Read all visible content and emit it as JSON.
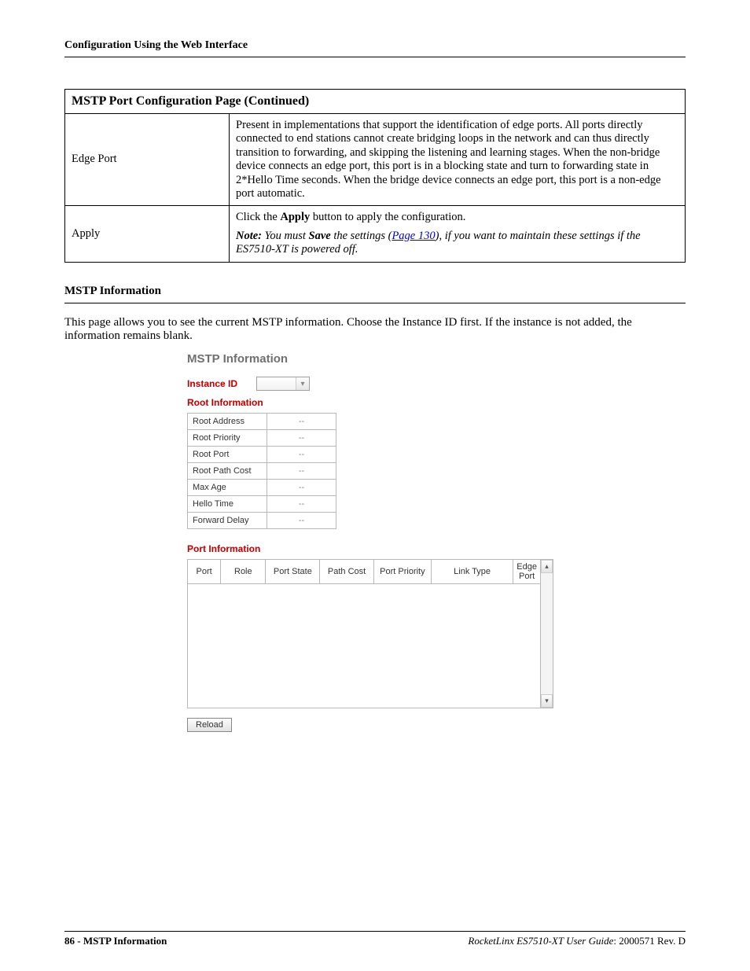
{
  "header": {
    "title": "Configuration Using the Web Interface"
  },
  "table": {
    "caption": "MSTP Port Configuration Page  (Continued)",
    "rows": [
      {
        "label": "Edge Port",
        "desc": "Present in implementations that support the identification of edge ports. All ports directly connected to end stations cannot create bridging loops in the network and can thus directly transition to forwarding, and skipping the listening and learning stages. When the non-bridge device connects an edge port, this port is in a blocking state and turn to forwarding state in 2*Hello Time seconds. When the bridge device connects an edge port, this port is a non-edge port automatic."
      },
      {
        "label": "Apply",
        "line1_a": "Click the ",
        "line1_b": "Apply",
        "line1_c": " button to apply the configuration.",
        "note_prefix": "Note:",
        "note_a": " You must ",
        "note_save": "Save",
        "note_b": " the settings (",
        "note_link": "Page 130",
        "note_c": "), if you want to maintain these settings if the ES7510-XT is powered off."
      }
    ]
  },
  "section": {
    "heading": "MSTP Information",
    "body": "This page allows you to see the current MSTP information. Choose the Instance ID first. If the instance is not added, the information remains blank."
  },
  "panel": {
    "title": "MSTP Information",
    "instance_label": "Instance ID",
    "root_heading": "Root Information",
    "root_rows": [
      {
        "k": "Root Address",
        "v": "--"
      },
      {
        "k": "Root Priority",
        "v": "--"
      },
      {
        "k": "Root Port",
        "v": "--"
      },
      {
        "k": "Root Path Cost",
        "v": "--"
      },
      {
        "k": "Max Age",
        "v": "--"
      },
      {
        "k": "Hello Time",
        "v": "--"
      },
      {
        "k": "Forward Delay",
        "v": "--"
      }
    ],
    "port_heading": "Port Information",
    "port_cols": [
      "Port",
      "Role",
      "Port State",
      "Path Cost",
      "Port Priority",
      "Link Type",
      "Edge Port"
    ],
    "reload": "Reload"
  },
  "footer": {
    "page_no": "86",
    "left_sep": " - ",
    "left_title": "MSTP Information",
    "product": "RocketLinx ES7510-XT  User Guide",
    "right_sep": ": ",
    "docnum": "2000571 Rev. D"
  }
}
